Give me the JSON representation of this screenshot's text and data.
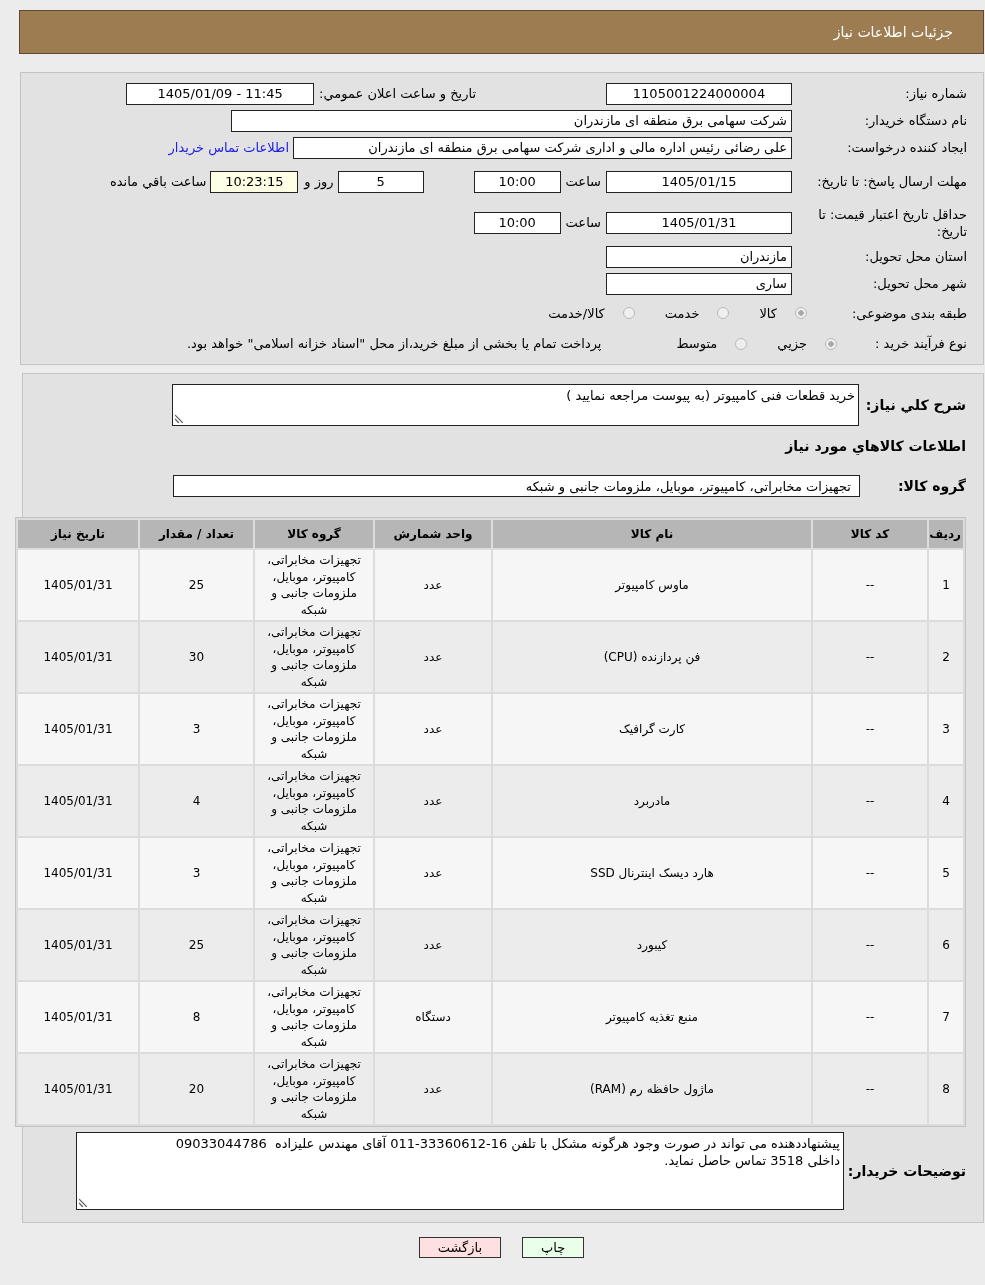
{
  "header": {
    "title": "جزئیات اطلاعات نیاز"
  },
  "details": {
    "need_number": {
      "label": "شماره نیاز:",
      "value": "1105001224000004"
    },
    "announcement": {
      "label": "تاریخ و ساعت اعلان عمومي:",
      "value": "1405/01/09 - 11:45"
    },
    "buyer_org": {
      "label": "نام دستگاه خریدار:",
      "value": "شرکت سهامی برق منطقه ای مازندران"
    },
    "requester": {
      "label": "ایجاد کننده درخواست:",
      "value": "علی رضائی رئیس اداره مالی و اداری شرکت سهامی برق منطقه ای مازندران",
      "link": "اطلاعات تماس خریدار"
    },
    "reply_deadline": {
      "label": "مهلت ارسال پاسخ: تا تاریخ:",
      "date": "1405/01/15",
      "time_label": "ساعت",
      "time": "10:00",
      "days": "5",
      "days_label": "روز و",
      "remaining": "10:23:15",
      "remaining_label": "ساعت باقي مانده"
    },
    "price_validity": {
      "label": "حداقل تاریخ اعتبار قیمت: تا تاریخ:",
      "date": "1405/01/31",
      "time_label": "ساعت",
      "time": "10:00"
    },
    "province": {
      "label": "استان محل تحویل:",
      "value": "مازندران"
    },
    "city": {
      "label": "شهر محل تحویل:",
      "value": "ساری"
    },
    "category": {
      "label": "طبقه بندی موضوعی:",
      "options": [
        {
          "label": "کالا",
          "selected": true
        },
        {
          "label": "خدمت",
          "selected": false
        },
        {
          "label": "کالا/خدمت",
          "selected": false
        }
      ]
    },
    "purchase_process": {
      "label": "نوع فرآیند خرید :",
      "options": [
        {
          "label": "جزيي",
          "selected": true
        },
        {
          "label": "متوسط",
          "selected": false
        }
      ],
      "note": "پرداخت تمام یا بخشی از مبلغ خرید،از محل \"اسناد خزانه اسلامی\" خواهد بود."
    }
  },
  "description": {
    "label": "شرح کلي نیاز:",
    "value": "خرید قطعات فنی کامپیوتر (به پیوست مراجعه نمایید )"
  },
  "goods": {
    "heading": "اطلاعات کالاهاي مورد نیاز",
    "group_label": "گروه کالا:",
    "group_value": "تجهیزات مخابراتی، کامپیوتر، موبایل، ملزومات جانبی و شبکه",
    "table": {
      "columns": [
        "ردیف",
        "کد کالا",
        "نام کالا",
        "واحد شمارش",
        "گروه کالا",
        "تعداد / مقدار",
        "تاریخ نیاز"
      ],
      "rows": [
        [
          "1",
          "--",
          "ماوس کامپیوتر",
          "عدد",
          "تجهیزات مخابراتی، کامپیوتر، موبایل، ملزومات جانبی و شبکه",
          "25",
          "1405/01/31"
        ],
        [
          "2",
          "--",
          "فن پردازنده (CPU)",
          "عدد",
          "تجهیزات مخابراتی، کامپیوتر، موبایل، ملزومات جانبی و شبکه",
          "30",
          "1405/01/31"
        ],
        [
          "3",
          "--",
          "کارت گرافیک",
          "عدد",
          "تجهیزات مخابراتی، کامپیوتر، موبایل، ملزومات جانبی و شبکه",
          "3",
          "1405/01/31"
        ],
        [
          "4",
          "--",
          "مادربرد",
          "عدد",
          "تجهیزات مخابراتی، کامپیوتر، موبایل، ملزومات جانبی و شبکه",
          "4",
          "1405/01/31"
        ],
        [
          "5",
          "--",
          "هارد دیسک اینترنال SSD",
          "عدد",
          "تجهیزات مخابراتی، کامپیوتر، موبایل، ملزومات جانبی و شبکه",
          "3",
          "1405/01/31"
        ],
        [
          "6",
          "--",
          "کیبورد",
          "عدد",
          "تجهیزات مخابراتی، کامپیوتر، موبایل، ملزومات جانبی و شبکه",
          "25",
          "1405/01/31"
        ],
        [
          "7",
          "--",
          "منبع تغذیه کامپیوتر",
          "دستگاه",
          "تجهیزات مخابراتی، کامپیوتر، موبایل، ملزومات جانبی و شبکه",
          "8",
          "1405/01/31"
        ],
        [
          "8",
          "--",
          "ماژول حافظه رم (RAM)",
          "عدد",
          "تجهیزات مخابراتی، کامپیوتر، موبایل، ملزومات جانبی و شبکه",
          "20",
          "1405/01/31"
        ]
      ]
    }
  },
  "buyer_notes": {
    "label": "توضیحات خریدار:",
    "value": "پیشنهاددهنده می تواند در صورت وجود هرگونه مشکل با تلفن 16-33360612-011 آقای مهندس علیزاده  09033044786 داخلی 3518 تماس حاصل نماید."
  },
  "buttons": [
    {
      "label": "چاپ",
      "kind": "print"
    },
    {
      "label": "بازگشت",
      "kind": "back"
    }
  ]
}
